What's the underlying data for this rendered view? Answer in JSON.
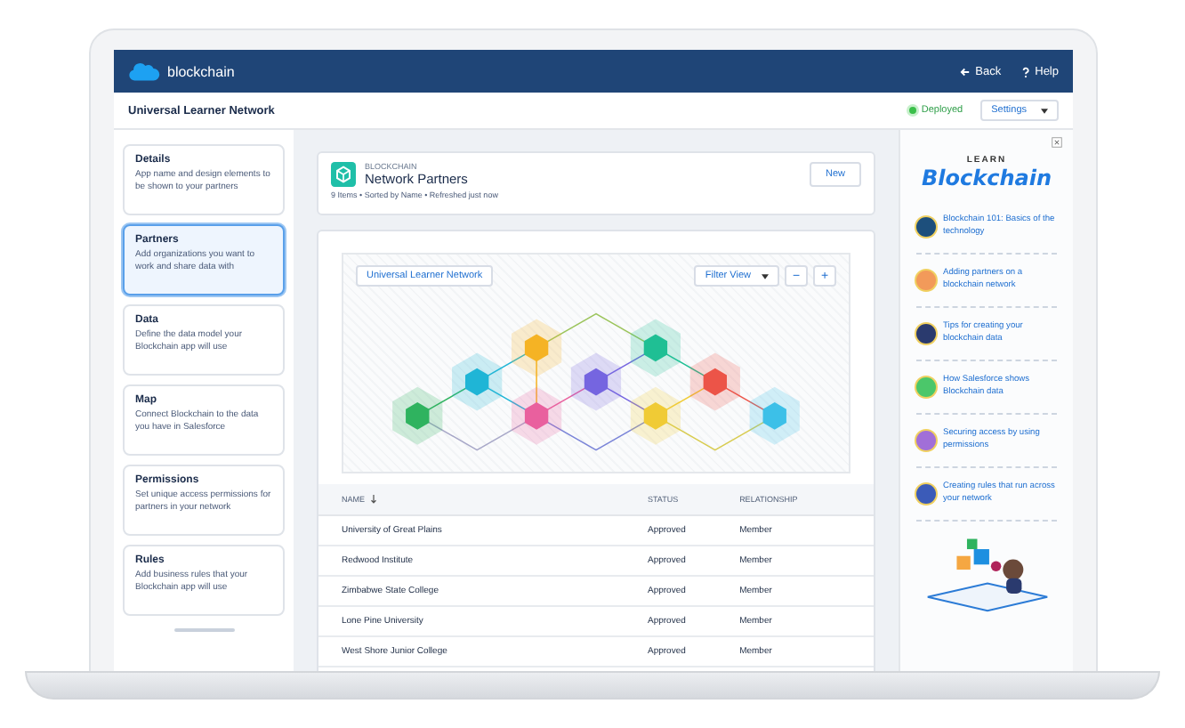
{
  "app": {
    "name": "blockchain"
  },
  "nav": {
    "back": "Back",
    "help": "Help"
  },
  "subheader": {
    "title": "Universal Learner Network",
    "status": "Deployed",
    "settings": "Settings"
  },
  "steps": [
    {
      "title": "Details",
      "description": "App name and design elements to be shown to your partners",
      "selected": false
    },
    {
      "title": "Partners",
      "description": "Add organizations you want to work and share data with",
      "selected": true
    },
    {
      "title": "Data",
      "description": "Define the data model your Blockchain app will use",
      "selected": false
    },
    {
      "title": "Map",
      "description": "Connect Blockchain to the data you have in Salesforce",
      "selected": false
    },
    {
      "title": "Permissions",
      "description": "Set unique access permissions for partners in your network",
      "selected": false
    },
    {
      "title": "Rules",
      "description": "Add business rules that your Blockchain app will use",
      "selected": false
    }
  ],
  "list_header": {
    "eyebrow": "BLOCKCHAIN",
    "title": "Network Partners",
    "meta": "9 Items • Sorted by Name • Refreshed just now",
    "new_button": "New"
  },
  "network": {
    "name": "Universal Learner Network",
    "filter": "Filter View",
    "zoom_out": "−",
    "zoom_in": "+",
    "nodes": [
      {
        "color": "#2fb35f"
      },
      {
        "color": "#1fb5d6"
      },
      {
        "color": "#f5b324"
      },
      {
        "color": "#e9609e"
      },
      {
        "color": "#7565e0"
      },
      {
        "color": "#1fbf94"
      },
      {
        "color": "#f0cb35"
      },
      {
        "color": "#ec5448"
      },
      {
        "color": "#3cc0e8"
      }
    ]
  },
  "table": {
    "columns": [
      "NAME",
      "STATUS",
      "RELATIONSHIP"
    ],
    "rows": [
      [
        "University of Great Plains",
        "Approved",
        "Member"
      ],
      [
        "Redwood Institute",
        "Approved",
        "Member"
      ],
      [
        "Zimbabwe State College",
        "Approved",
        "Member"
      ],
      [
        "Lone Pine University",
        "Approved",
        "Member"
      ],
      [
        "West Shore Junior College",
        "Approved",
        "Member"
      ]
    ]
  },
  "learn": {
    "eyebrow": "LEARN",
    "title": "Blockchain",
    "items": [
      {
        "label": "Blockchain 101: Basics of the technology",
        "color": "#1d4f7c"
      },
      {
        "label": "Adding partners on a blockchain network",
        "color": "#f29a5a"
      },
      {
        "label": "Tips for creating your blockchain data",
        "color": "#2a3a6e"
      },
      {
        "label": "How Salesforce shows Blockchain data",
        "color": "#4bc76a"
      },
      {
        "label": "Securing access by using permissions",
        "color": "#a16fd8"
      },
      {
        "label": "Creating rules that run across your network",
        "color": "#3b5bb8"
      }
    ]
  }
}
